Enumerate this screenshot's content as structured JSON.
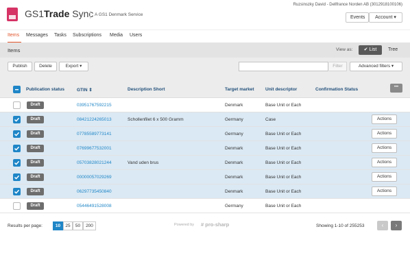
{
  "header": {
    "brand_prefix": "GS1",
    "brand_bold": "Trade",
    "brand_suffix": " Sync",
    "subtitle": "A GS1 Denmark Service",
    "user_info": "Ruzsinszky David - Dellfrance Norden AB (3012918100106)",
    "events_label": "Events",
    "account_label": "Account",
    "logo_color": "#d63366"
  },
  "nav": {
    "items": [
      "Items",
      "Messages",
      "Tasks",
      "Subscriptions",
      "Media",
      "Users"
    ],
    "active": "Items",
    "accent": "#e2552b"
  },
  "section": {
    "title": "Items",
    "view_as": "View as:",
    "list_label": "List",
    "tree_label": "Tree"
  },
  "toolbar": {
    "publish": "Publish",
    "delete": "Delete",
    "export": "Export",
    "search_value": "",
    "filter": "Filter",
    "advanced_filters": "Advanced filters"
  },
  "table": {
    "columns": {
      "status": "Publication status",
      "gtin": "GTIN",
      "desc": "Description Short",
      "market": "Target market",
      "unit": "Unit descriptor",
      "confirmation": "Confirmation Status"
    },
    "rows": [
      {
        "selected": false,
        "status": "Draft",
        "gtin": "03951767592215",
        "desc": "",
        "market": "Denmark",
        "unit": "Base Unit or Each",
        "action": ""
      },
      {
        "selected": true,
        "status": "Draft",
        "gtin": "08421224265013",
        "desc": "Schollenfilet 6 x 500 Gramm",
        "market": "Germany",
        "unit": "Case",
        "action": "Actions"
      },
      {
        "selected": true,
        "status": "Draft",
        "gtin": "07785589773141",
        "desc": "",
        "market": "Germany",
        "unit": "Base Unit or Each",
        "action": "Actions"
      },
      {
        "selected": true,
        "status": "Draft",
        "gtin": "07699677532001",
        "desc": "",
        "market": "Denmark",
        "unit": "Base Unit or Each",
        "action": "Actions"
      },
      {
        "selected": true,
        "status": "Draft",
        "gtin": "05703828021244",
        "desc": "Vand uden brus",
        "market": "Denmark",
        "unit": "Base Unit or Each",
        "action": "Actions"
      },
      {
        "selected": true,
        "status": "Draft",
        "gtin": "00000057029269",
        "desc": "",
        "market": "Denmark",
        "unit": "Base Unit or Each",
        "action": "Actions"
      },
      {
        "selected": true,
        "status": "Draft",
        "gtin": "06297735450840",
        "desc": "",
        "market": "Denmark",
        "unit": "Base Unit or Each",
        "action": "Actions"
      },
      {
        "selected": false,
        "status": "Draft",
        "gtin": "05446491528008",
        "desc": "",
        "market": "Germany",
        "unit": "Base Unit or Each",
        "action": ""
      }
    ]
  },
  "footer": {
    "results_per_page_label": "Results per page:",
    "page_sizes": [
      "10",
      "25",
      "50",
      "200"
    ],
    "active_size": "10",
    "powered_by": "Powered by",
    "powered_brand": "pro-sharp",
    "showing": "Showing 1-10 of 255253"
  }
}
